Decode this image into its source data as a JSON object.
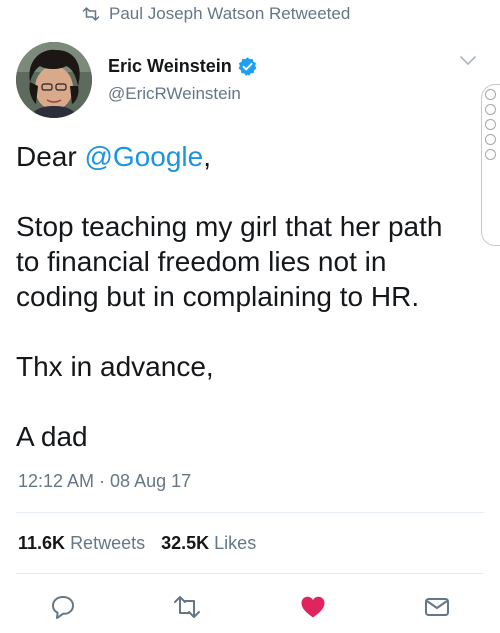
{
  "retweet_context": {
    "text": "Paul Joseph Watson Retweeted"
  },
  "author": {
    "name": "Eric Weinstein",
    "handle": "@EricRWeinstein",
    "verified": true
  },
  "tweet": {
    "greeting_prefix": "Dear ",
    "mention": "@Google",
    "greeting_suffix": ",",
    "line_1": "Stop teaching my girl that her path",
    "line_2": "to financial freedom lies not in",
    "line_3": "coding but in complaining to HR.",
    "line_4": "Thx in advance,",
    "line_5": "A dad"
  },
  "timestamp": "12:12 AM · 08 Aug 17",
  "stats": {
    "retweets_count": "11.6K",
    "retweets_label": "Retweets",
    "likes_count": "32.5K",
    "likes_label": "Likes"
  },
  "colors": {
    "link": "#1b95e0",
    "muted": "#657786",
    "like_active": "#e0245e",
    "verified": "#1da1f2"
  },
  "icons": {
    "retweet_context": "retweet-icon",
    "verified": "verified-badge-icon",
    "menu": "chevron-down-icon",
    "reply": "reply-icon",
    "retweet": "retweet-icon",
    "like": "heart-icon",
    "share": "envelope-icon"
  }
}
